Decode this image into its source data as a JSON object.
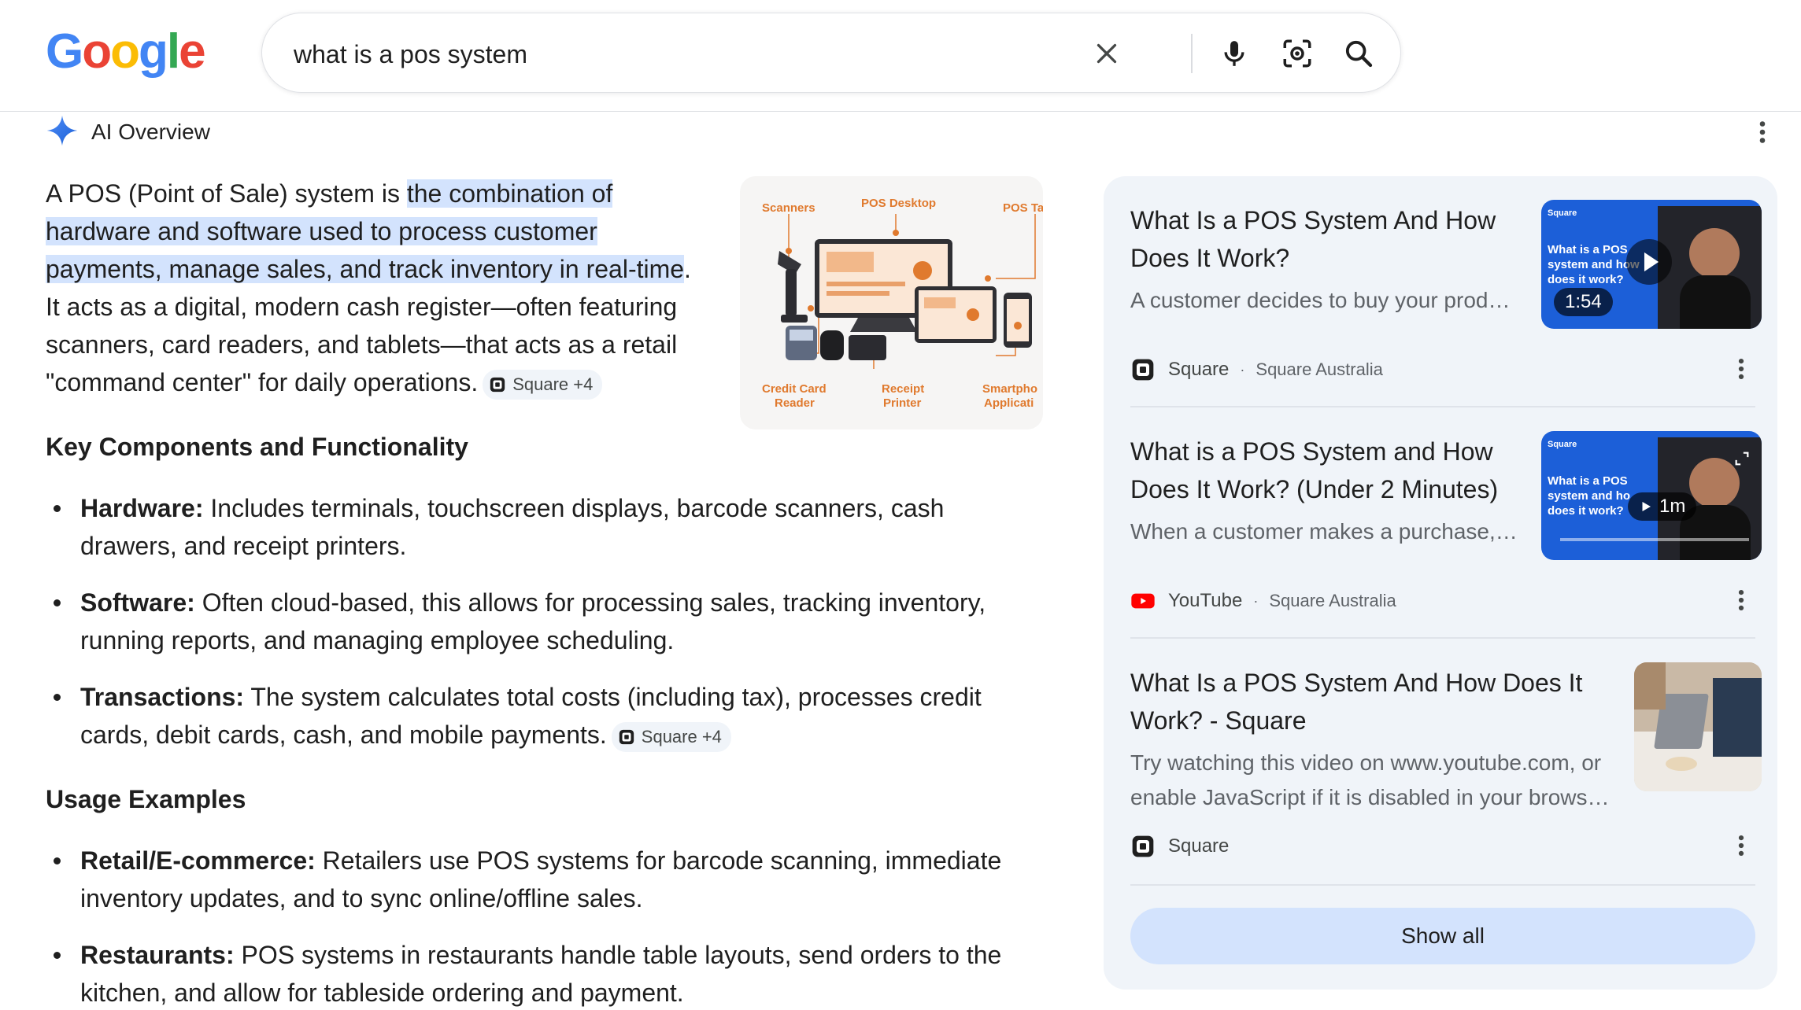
{
  "search": {
    "query": "what is a pos system"
  },
  "ai_overview": {
    "label": "AI Overview",
    "intro_1": "A POS (Point of Sale) system is ",
    "intro_hl_1": "the combination of",
    "intro_hl_2": "hardware and software used to process customer",
    "intro_hl_3": "payments, manage sales, and track inventory in real-time",
    "intro_2": ".",
    "intro_3": "It acts as a digital, modern cash register—often featuring",
    "intro_4": "scanners, card readers, and tablets—that acts as a retail",
    "intro_5": "\"command center\" for daily operations.",
    "intro_chip": "Square +4",
    "diagram_labels": [
      "Scanners",
      "POS Desktop",
      "POS Ta",
      "Credit Card",
      "Reader",
      "Receipt",
      "Printer",
      "Smartpho",
      "Applicati"
    ],
    "section_1": "Key Components and Functionality",
    "components": [
      {
        "term": "Hardware:",
        "line1": " Includes terminals, touchscreen displays, barcode scanners, cash",
        "line2": "drawers, and receipt printers."
      },
      {
        "term": "Software:",
        "line1": " Often cloud-based, this allows for processing sales, tracking inventory,",
        "line2": "running reports, and managing employee scheduling."
      },
      {
        "term": "Transactions:",
        "line1": " The system calculates total costs (including tax), processes credit",
        "line2": "cards, debit cards, cash, and mobile payments.",
        "chip": "Square +4"
      }
    ],
    "section_2": "Usage Examples",
    "examples": [
      {
        "term": "Retail/E-commerce:",
        "line1": " Retailers use POS systems for barcode scanning, immediate",
        "line2": "inventory updates, and to sync online/offline sales."
      },
      {
        "term": "Restaurants:",
        "line1": " POS systems in restaurants handle table layouts, send orders to the",
        "line2": "kitchen, and allow for tableside ordering and payment."
      }
    ]
  },
  "sources": {
    "cards": [
      {
        "title_1": "What Is a POS System And How",
        "title_2": "Does It Work?",
        "snippet_1": "A customer decides to buy your prod…",
        "source": "Square",
        "publisher": "Square Australia",
        "thumb_brand": "Square",
        "thumb_text_1": "What is a POS",
        "thumb_text_2": "system and how",
        "thumb_text_3": "does it work?",
        "duration": "1:54"
      },
      {
        "title_1": "What is a POS System and How",
        "title_2": "Does It Work? (Under 2 Minutes)",
        "snippet_1": "When a customer makes a purchase,…",
        "source": "YouTube",
        "publisher": "Square Australia",
        "thumb_brand": "Square",
        "thumb_text_1": "What is a POS",
        "thumb_text_2": "system and ho",
        "thumb_text_3": "does it work?",
        "duration": "1m"
      },
      {
        "title_1": "What Is a POS System And How Does It",
        "title_2": "Work? - Square",
        "snippet_1": "Try watching this video on www.youtube.com, or",
        "snippet_2": "enable JavaScript if it is disabled in your brows…",
        "source": "Square"
      }
    ],
    "show_all": "Show all"
  },
  "colors": {
    "google_blue": "#4285F4",
    "google_red": "#EA4335",
    "google_yellow": "#FBBC05",
    "google_green": "#34A853",
    "highlight": "#d3e3fd",
    "panel_bg": "#f0f4f9",
    "youtube_red": "#ff0000"
  },
  "icons": [
    "close-icon",
    "microphone-icon",
    "lens-icon",
    "search-icon",
    "sparkle-icon",
    "more-vert-icon",
    "square-logo-icon",
    "youtube-logo-icon",
    "play-icon"
  ]
}
